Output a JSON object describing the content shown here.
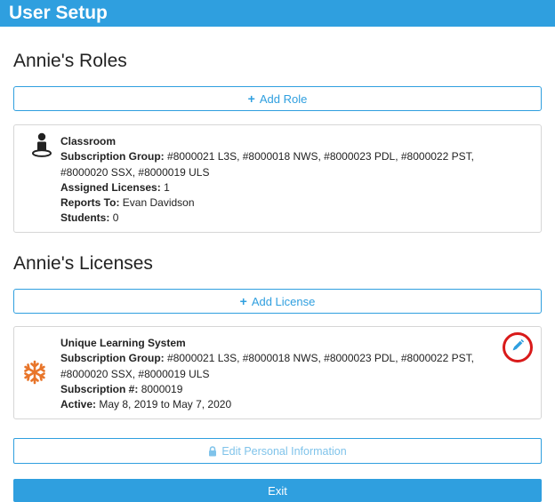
{
  "header": {
    "title": "User Setup"
  },
  "roles": {
    "title": "Annie's Roles",
    "add_label": "Add Role",
    "card": {
      "name": "Classroom",
      "subscription_group_label": "Subscription Group:",
      "subscription_group": "#8000021 L3S, #8000018 NWS, #8000023 PDL, #8000022 PST, #8000020 SSX, #8000019 ULS",
      "assigned_licenses_label": "Assigned Licenses:",
      "assigned_licenses": "1",
      "reports_to_label": "Reports To:",
      "reports_to": "Evan Davidson",
      "students_label": "Students:",
      "students": "0"
    }
  },
  "licenses": {
    "title": "Annie's Licenses",
    "add_label": "Add License",
    "card": {
      "name": "Unique Learning System",
      "subscription_group_label": "Subscription Group:",
      "subscription_group": "#8000021 L3S, #8000018 NWS, #8000023 PDL, #8000022 PST, #8000020 SSX, #8000019 ULS",
      "subscription_number_label": "Subscription #:",
      "subscription_number": "8000019",
      "active_label": "Active:",
      "active": "May 8, 2019 to May 7, 2020"
    }
  },
  "actions": {
    "edit_personal_label": "Edit Personal Information",
    "exit_label": "Exit"
  },
  "colors": {
    "accent": "#2f9fdf",
    "license_icon": "#e8752a",
    "highlight_ring": "#d91a1a"
  }
}
